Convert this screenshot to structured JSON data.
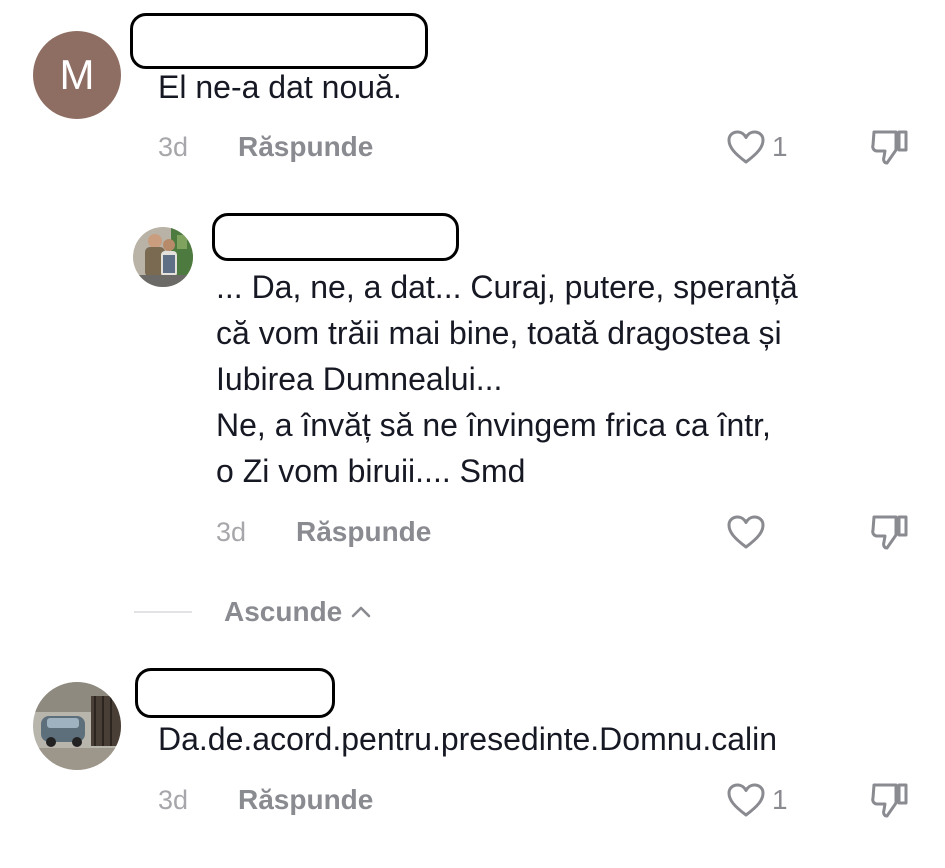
{
  "comments": [
    {
      "avatar_letter": "M",
      "avatar_color": "#8e6e63",
      "text": "El ne-a dat nouă.",
      "time": "3d",
      "reply_label": "Răspunde",
      "like_count": "1",
      "like_icon": "heart-outline-icon",
      "dislike_icon": "thumbs-down-icon"
    },
    {
      "text": "... Da, ne, a dat... Curaj, putere, speranță\ncă vom trăii mai bine, toată dragostea și\nIubirea Dumnealui...\nNe, a învăț să ne învingem frica ca într,\no Zi vom biruii.... Smd",
      "time": "3d",
      "reply_label": "Răspunde",
      "like_count": "",
      "like_icon": "heart-outline-icon",
      "dislike_icon": "thumbs-down-icon"
    },
    {
      "text": "Da.de.acord.pentru.presedinte.Domnu.calin",
      "time": "3d",
      "reply_label": "Răspunde",
      "like_count": "1",
      "like_icon": "heart-outline-icon",
      "dislike_icon": "thumbs-down-icon"
    }
  ],
  "replies_toggle": {
    "label": "Ascunde",
    "icon": "chevron-up-icon"
  },
  "colors": {
    "text_primary": "#161823",
    "text_secondary": "#8a8b91",
    "text_tertiary": "#a7a7ab",
    "redaction_border": "#000000"
  }
}
